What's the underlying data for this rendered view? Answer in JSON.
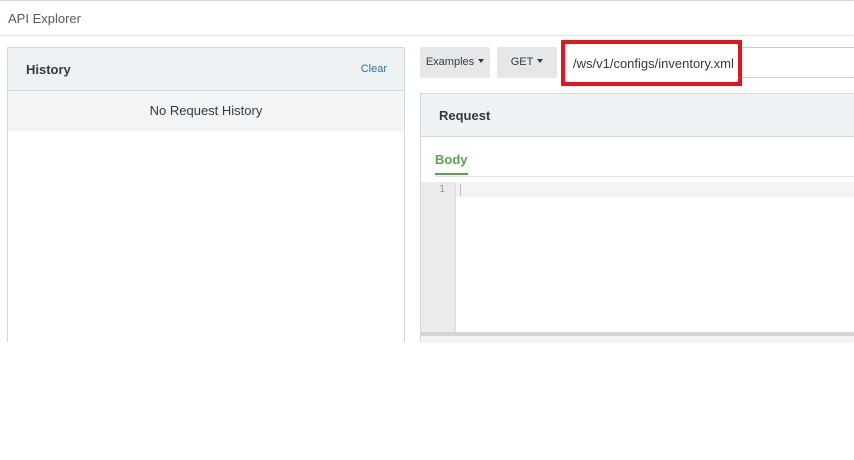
{
  "app": {
    "title": "API Explorer"
  },
  "history": {
    "title": "History",
    "clear_label": "Clear",
    "empty_message": "No Request History"
  },
  "toolbar": {
    "examples_label": "Examples",
    "method_label": "GET",
    "url_value": "/ws/v1/configs/inventory.xml"
  },
  "request": {
    "title": "Request",
    "tabs": [
      {
        "label": "Body",
        "active": true
      }
    ],
    "editor": {
      "line_numbers": [
        "1"
      ],
      "content": ""
    }
  },
  "icons": {
    "dropdown_caret": "chevron-down-icon"
  },
  "colors": {
    "highlight_border": "#e2161f",
    "active_tab": "#5aa34a",
    "link": "#2a6fa8"
  }
}
